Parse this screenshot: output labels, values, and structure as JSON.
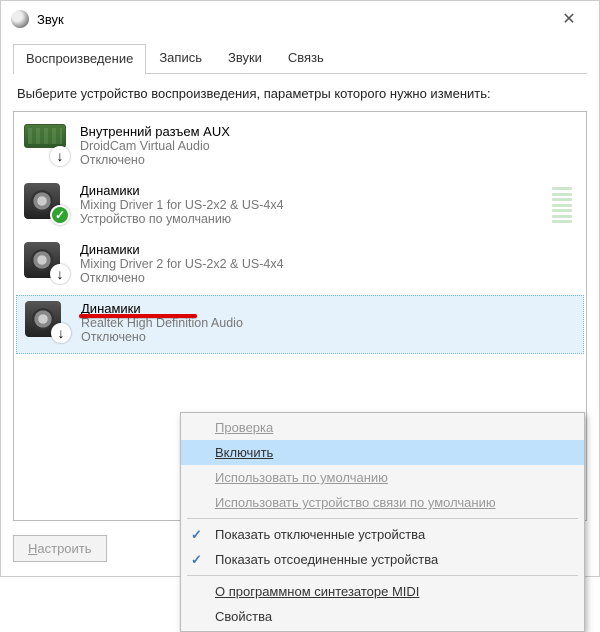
{
  "window": {
    "title": "Звук"
  },
  "tabs": [
    {
      "label": "Воспроизведение",
      "active": true
    },
    {
      "label": "Запись",
      "active": false
    },
    {
      "label": "Звуки",
      "active": false
    },
    {
      "label": "Связь",
      "active": false
    }
  ],
  "instruction": "Выберите устройство воспроизведения, параметры которого нужно изменить:",
  "devices": [
    {
      "name": "Внутренний разъем  AUX",
      "desc": "DroidCam Virtual Audio",
      "status": "Отключено",
      "icon": "aux",
      "badge": "down"
    },
    {
      "name": "Динамики",
      "desc": "Mixing Driver 1 for US-2x2 & US-4x4",
      "status": "Устройство по умолчанию",
      "icon": "speaker",
      "badge": "ok",
      "meter": true
    },
    {
      "name": "Динамики",
      "desc": "Mixing Driver 2 for US-2x2 & US-4x4",
      "status": "Отключено",
      "icon": "speaker",
      "badge": "down"
    },
    {
      "name": "Динамики",
      "desc": "Realtek High Definition Audio",
      "status": "Отключено",
      "icon": "speaker",
      "badge": "down",
      "selected": true
    }
  ],
  "configure_button": "Настроить",
  "context_menu": {
    "items": [
      {
        "label": "Проверка",
        "disabled": true
      },
      {
        "label": "Включить",
        "highlight": true
      },
      {
        "label": "Использовать по умолчанию",
        "disabled": true
      },
      {
        "label": "Использовать устройство связи по умолчанию",
        "disabled": true
      }
    ],
    "items2": [
      {
        "label": "Показать отключенные устройства",
        "checked": true
      },
      {
        "label": "Показать отсоединенные устройства",
        "checked": true
      }
    ],
    "items3": [
      {
        "label": "О программном синтезаторе MIDI"
      },
      {
        "label": "Свойства"
      }
    ]
  }
}
